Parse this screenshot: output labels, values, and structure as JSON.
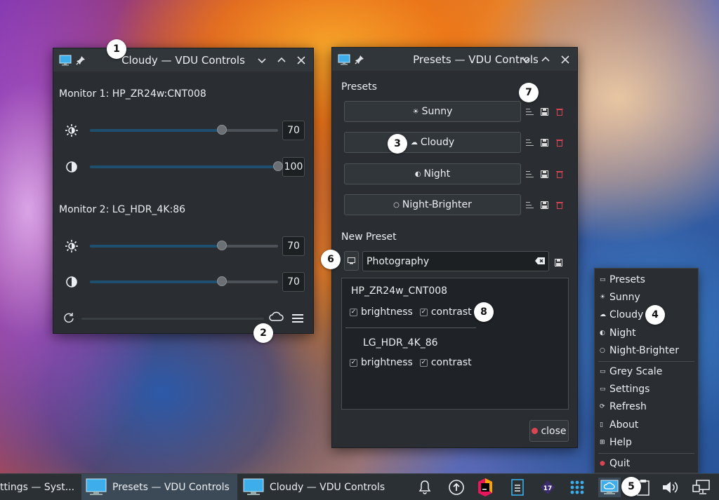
{
  "colors": {
    "accent": "#3daee9",
    "danger": "#da4453",
    "window_bg": "#2a2e32",
    "titlebar_bg": "#31363b"
  },
  "main_window": {
    "title": "Cloudy — VDU Controls",
    "monitors": [
      {
        "name": "Monitor 1: HP_ZR24w:CNT008",
        "brightness": 70,
        "contrast": 100
      },
      {
        "name": "Monitor 2: LG_HDR_4K:86",
        "brightness": 70,
        "contrast": 70
      }
    ],
    "footer_icons": [
      "refresh-icon",
      "cloud-icon",
      "hamburger-menu-icon"
    ]
  },
  "presets_window": {
    "title": "Presets — VDU Controls",
    "presets_heading": "Presets",
    "presets": [
      {
        "icon": "☀",
        "label": "Sunny"
      },
      {
        "icon": "☁",
        "label": "Cloudy"
      },
      {
        "icon": "◐",
        "label": "Night"
      },
      {
        "icon": "○",
        "label": "Night-Brighter"
      }
    ],
    "new_preset_heading": "New Preset",
    "new_preset_value": "Photography",
    "vdus": [
      {
        "name": "HP_ZR24w_CNT008",
        "options": [
          "brightness",
          "contrast"
        ]
      },
      {
        "name": "LG_HDR_4K_86",
        "options": [
          "brightness",
          "contrast"
        ]
      }
    ],
    "close_label": "close"
  },
  "context_menu": {
    "items": [
      {
        "icon": "▭",
        "label": "Presets"
      },
      {
        "icon": "☀",
        "label": "Sunny"
      },
      {
        "icon": "☁",
        "label": "Cloudy"
      },
      {
        "icon": "◐",
        "label": "Night"
      },
      {
        "icon": "○",
        "label": "Night-Brighter"
      },
      {
        "icon": "▭",
        "label": "Grey Scale"
      },
      {
        "icon": "▭",
        "label": "Settings"
      },
      {
        "icon": "⟳",
        "label": "Refresh"
      },
      {
        "icon": "▯",
        "label": "About"
      },
      {
        "icon": "⊞",
        "label": "Help"
      },
      {
        "icon": "●",
        "label": "Quit"
      }
    ]
  },
  "taskbar": {
    "tasks": [
      "ttings — Syst...",
      "Presets — VDU Controls",
      "Cloudy — VDU Controls"
    ]
  },
  "markers": [
    "1",
    "2",
    "3",
    "4",
    "5",
    "6",
    "7",
    "8"
  ]
}
